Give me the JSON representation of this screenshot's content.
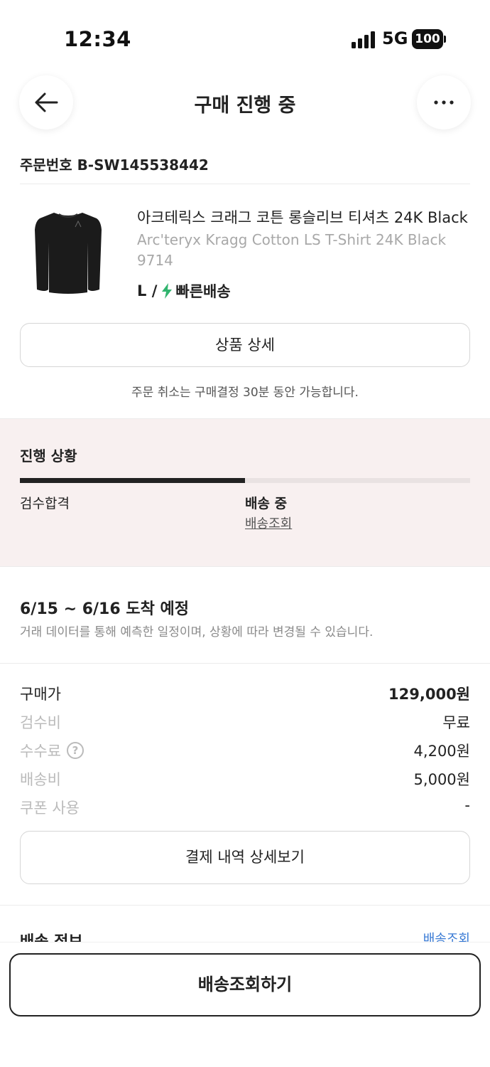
{
  "status_bar": {
    "time": "12:34",
    "network": "5G",
    "battery": "100"
  },
  "header": {
    "title": "구매 진행 중"
  },
  "order": {
    "number": "주문번호 B-SW145538442"
  },
  "product": {
    "name_ko": "아크테릭스 크래그 코튼 롱슬리브 티셔츠 24K Black",
    "name_en": "Arc'teryx Kragg Cotton LS T-Shirt 24K Black 9714",
    "size": "L /",
    "shipping_type": "빠른배송",
    "detail_button": "상품 상세",
    "cancel_note": "주문 취소는 구매결정 30분 동안 가능합니다."
  },
  "progress": {
    "title": "진행 상황",
    "fraction": 0.5,
    "steps": [
      {
        "label": "검수합격"
      },
      {
        "label": "배송 중"
      }
    ],
    "track_link": "배송조회"
  },
  "arrival": {
    "title": "6/15 ~ 6/16 도착 예정",
    "note": "거래 데이터를 통해 예측한 일정이며, 상황에 따라 변경될 수 있습니다."
  },
  "price": {
    "rows": [
      {
        "label": "구매가",
        "value": "129,000원"
      },
      {
        "label": "검수비",
        "value": "무료"
      },
      {
        "label": "수수료",
        "value": "4,200원"
      },
      {
        "label": "배송비",
        "value": "5,000원"
      },
      {
        "label": "쿠폰 사용",
        "value": "-"
      }
    ],
    "detail_button": "결제 내역 상세보기"
  },
  "shipping_info": {
    "title": "배송 정보",
    "link": "배송조회"
  },
  "bottom": {
    "button": "배송조회하기"
  },
  "colors": {
    "progress_bg": "#f8f0f0",
    "bolt": "#31b46e",
    "link": "#3a7bd5"
  }
}
